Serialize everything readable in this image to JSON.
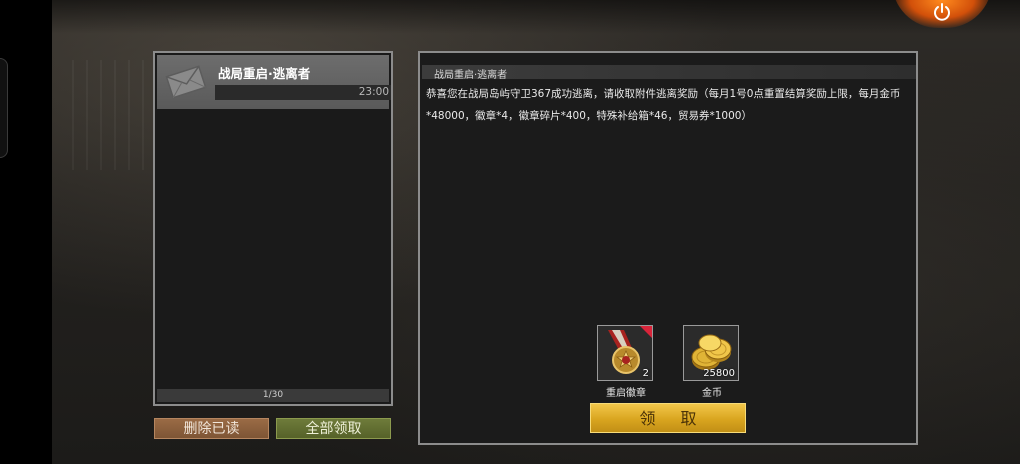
{
  "mail_list": {
    "items": [
      {
        "title": "战局重启·逃离者",
        "time": "23:00"
      }
    ],
    "pager": "1/30"
  },
  "buttons": {
    "delete_read": "删除已读",
    "claim_all": "全部领取",
    "claim": "领 取"
  },
  "mail_detail": {
    "title": "战局重启·逃离者",
    "body": "恭喜您在战局岛屿守卫367成功逃离，请收取附件逃离奖励（每月1号0点重置结算奖励上限，每月金币*48000，徽章*4，徽章碎片*400，特殊补给箱*46，贸易券*1000）"
  },
  "rewards": [
    {
      "name": "重启徽章",
      "count": "2",
      "icon": "medal-icon"
    },
    {
      "name": "金币",
      "count": "25800",
      "icon": "gold-coins-icon"
    }
  ],
  "colors": {
    "claim_button": "#d9a51f",
    "delete_button": "#9a6b45",
    "claim_all_button": "#6e7b3a",
    "power_glow": "#ff8a1e"
  }
}
